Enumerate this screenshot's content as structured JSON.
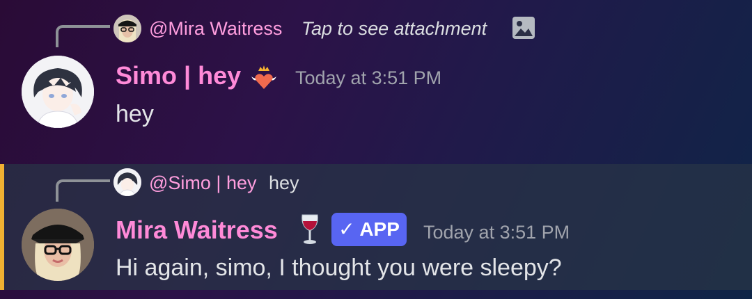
{
  "messages": [
    {
      "reply": {
        "mention": "@Mira Waitress",
        "preview": "Tap to see attachment",
        "attachment_icon": "image-icon"
      },
      "author": "Simo | hey",
      "author_badge_icon": "heart-crown-icon",
      "timestamp": "Today at 3:51 PM",
      "content": "hey",
      "colors": {
        "author": "#ff8ad8"
      }
    },
    {
      "reply": {
        "mention": "@Simo | hey",
        "preview": "hey"
      },
      "author": "Mira Waitress",
      "author_badge_icon": "wine-glass-icon",
      "app_badge": "APP",
      "timestamp": "Today at 3:51 PM",
      "content": "Hi again, simo, I thought you were sleepy?",
      "highlighted": true,
      "colors": {
        "author": "#ff8ad8",
        "highlight_bar": "#f0b132",
        "app_badge": "#5865f2"
      }
    }
  ]
}
